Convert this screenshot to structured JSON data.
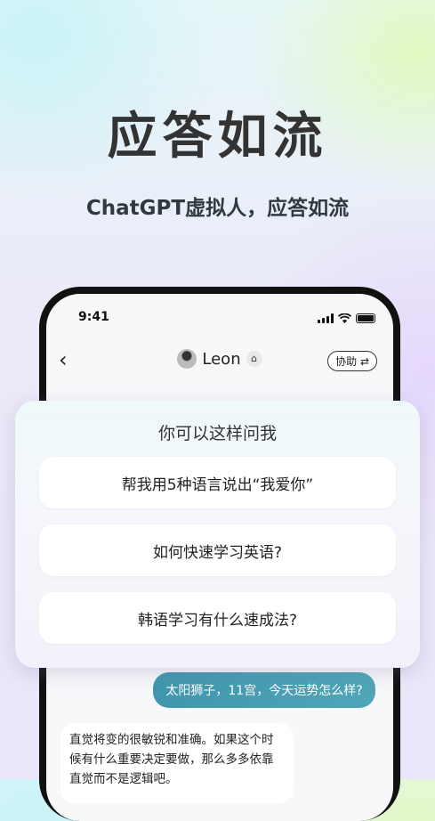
{
  "promo": {
    "headline": "应答如流",
    "subtitle": "ChatGPT虚拟人，应答如流"
  },
  "status_bar": {
    "time": "9:41"
  },
  "chat_header": {
    "back_icon": "chevron-left-icon",
    "contact_name": "Leon",
    "badge_icon": "home-icon",
    "assist_label": "协助 ⇄"
  },
  "suggestions": {
    "title": "你可以这样问我",
    "items": [
      "帮我用5种语言说出“我爱你”",
      "如何快速学习英语?",
      "韩语学习有什么速成法?"
    ]
  },
  "messages": {
    "user": "太阳狮子，11宫，今天运势怎么样?",
    "bot": "直觉将变的很敏锐和准确。如果这个时候有什么重要决定要做，那么多多依靠直觉而不是逻辑吧。"
  },
  "colors": {
    "user_bubble": "#4399ae",
    "headline": "#333333"
  }
}
